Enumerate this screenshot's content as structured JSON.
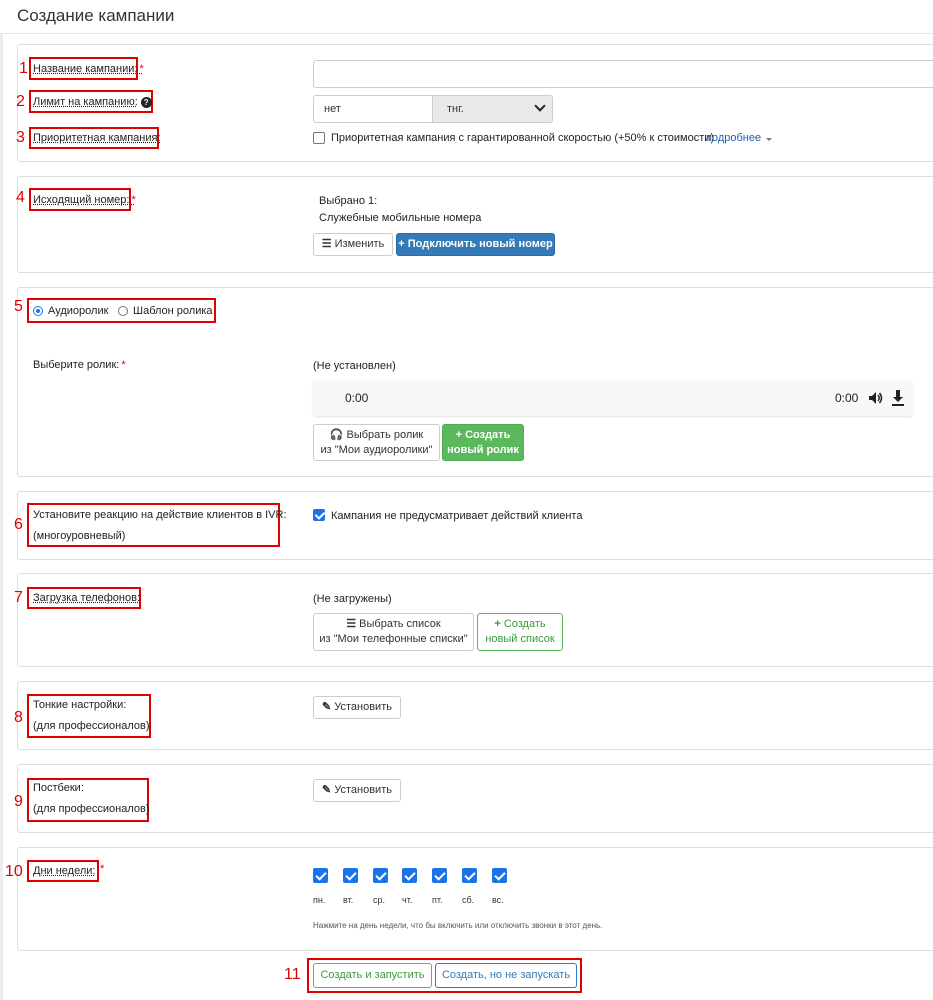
{
  "page": {
    "title": "Создание кампании"
  },
  "markers": [
    "1",
    "2",
    "3",
    "4",
    "5",
    "6",
    "7",
    "8",
    "9",
    "10",
    "11"
  ],
  "campaign": {
    "name_label": "Название кампании:",
    "name_value": "",
    "limit_label": "Лимит на кампанию:",
    "limit_value": "нет",
    "currency": "тнг.",
    "priority_label": "Приоритетная кампания:",
    "priority_checkbox_label": "Приоритетная кампания с гарантированной скоростью (+50% к стоимости)",
    "priority_checked": false,
    "more_link": "подробнее"
  },
  "outgoing": {
    "label": "Исходящий номер:",
    "selected_count": "Выбрано 1:",
    "selected_item": "Служебные мобильные номера",
    "change_button": "Изменить",
    "connect_button": "Подключить новый номер"
  },
  "audio": {
    "radio_audio": "Аудиоролик",
    "radio_template": "Шаблон ролика",
    "selected_radio": "audio",
    "choose_label": "Выберите ролик:",
    "status": "(Не установлен)",
    "time_current": "0:00",
    "time_total": "0:00",
    "choose_button_line1": "Выбрать ролик",
    "choose_button_line2": "из \"Мои аудиоролики\"",
    "create_button_line1": "Создать",
    "create_button_line2": "новый ролик"
  },
  "ivr": {
    "label_line1": "Установите реакцию на действие клиентов в IVR:",
    "label_line2": "(многоуровневый)",
    "checkbox_label": "Кампания не предусматривает действий клиента",
    "checked": true
  },
  "phones": {
    "label": "Загрузка телефонов:",
    "status": "(Не загружены)",
    "choose_button_line1": "Выбрать список",
    "choose_button_line2": "из \"Мои телефонные списки\"",
    "create_button_line1": "Создать",
    "create_button_line2": "новый список"
  },
  "fine_settings": {
    "label_line1": "Тонкие настройки:",
    "label_line2": "(для профессионалов)",
    "button": "Установить"
  },
  "postbacks": {
    "label_line1": "Постбеки:",
    "label_line2": "(для профессионалов)",
    "button": "Установить"
  },
  "weekdays": {
    "label": "Дни недели:",
    "days": [
      {
        "label": "пн.",
        "checked": true
      },
      {
        "label": "вт.",
        "checked": true
      },
      {
        "label": "ср.",
        "checked": true
      },
      {
        "label": "чт.",
        "checked": true
      },
      {
        "label": "пт.",
        "checked": true
      },
      {
        "label": "сб.",
        "checked": true
      },
      {
        "label": "вс.",
        "checked": true
      }
    ],
    "hint": "Нажмите на день недели, что бы включить или отключить звонки в этот день."
  },
  "actions": {
    "create_and_start": "Создать и запустить",
    "create_no_start": "Создать, но не запускать"
  },
  "colors": {
    "annotation": "#e00000",
    "primary": "#337ab7",
    "success": "#5cb85c",
    "checkbox": "#1a73e8"
  }
}
